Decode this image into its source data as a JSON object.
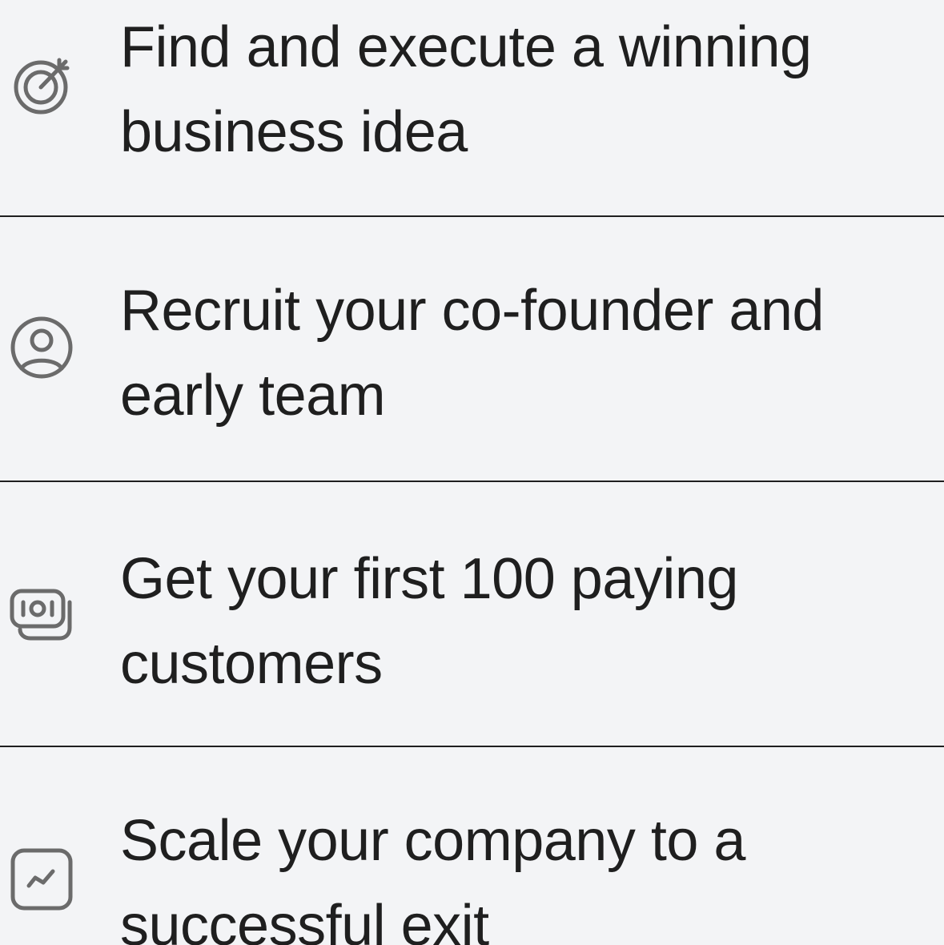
{
  "features": [
    {
      "icon": "target-icon",
      "text": "Find and execute a winning business idea",
      "line1": "Find and execute a winning",
      "line2": "business idea"
    },
    {
      "icon": "user-circle-icon",
      "text": "Recruit your co-founder and early team",
      "line1": "Recruit your co-founder and",
      "line2": "early team"
    },
    {
      "icon": "money-stack-icon",
      "text": "Get your first 100 paying customers",
      "line1": "Get your first 100 paying",
      "line2": "customers"
    },
    {
      "icon": "trend-chart-icon",
      "text": "Scale your company to a successful exit",
      "line1": "Scale your company to a",
      "line2": "successful exit"
    }
  ],
  "colors": {
    "background": "#f3f4f6",
    "text": "#1f1f1f",
    "icon": "#6b6b6b",
    "divider": "#1f1f1f"
  }
}
